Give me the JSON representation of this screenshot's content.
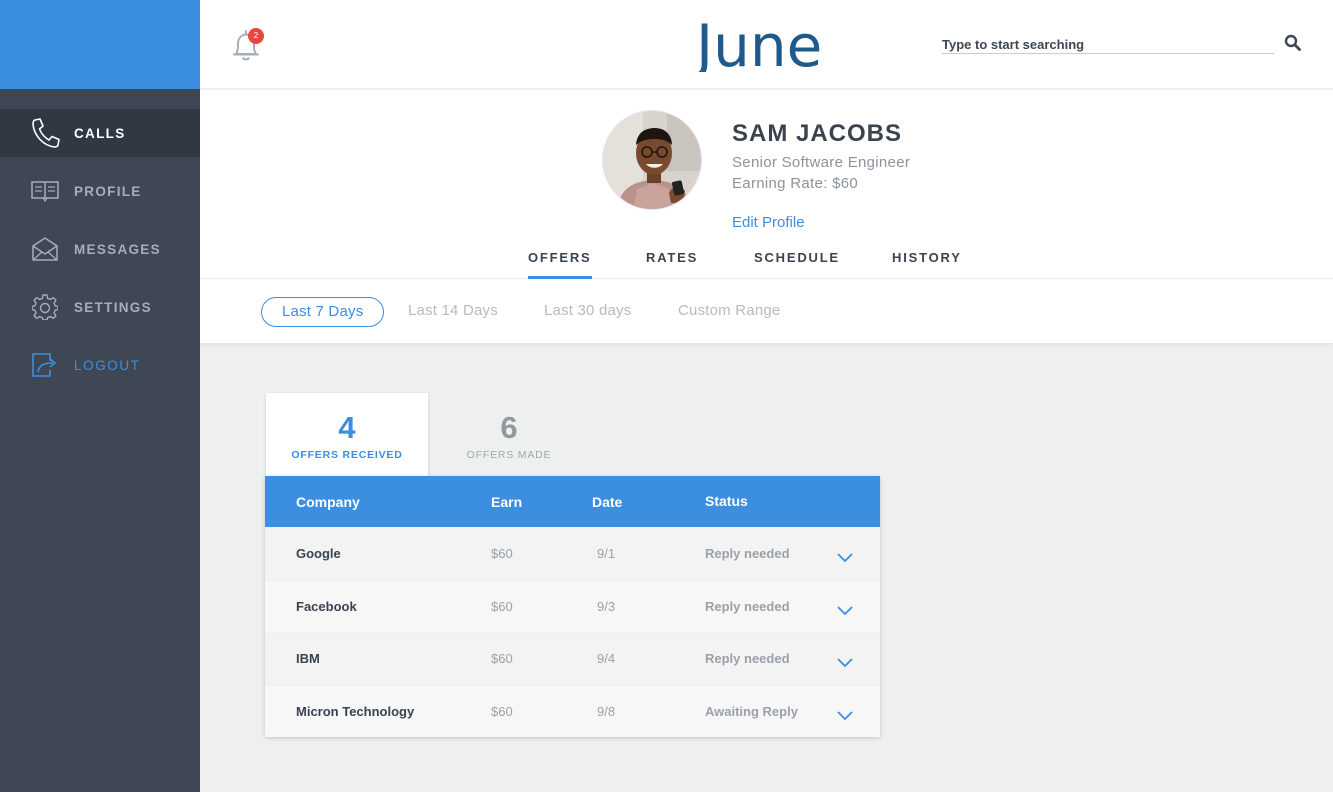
{
  "brand": {
    "logo_text": "June",
    "accent": "#3b8ee0",
    "sidebar_bg": "#3e4753"
  },
  "sidebar": {
    "items": [
      {
        "label": "CALLS",
        "icon": "phone-icon"
      },
      {
        "label": "PROFILE",
        "icon": "book-icon"
      },
      {
        "label": "MESSAGES",
        "icon": "envelope-icon"
      },
      {
        "label": "SETTINGS",
        "icon": "gear-icon"
      },
      {
        "label": "LOGOUT",
        "icon": "logout-icon"
      }
    ]
  },
  "header": {
    "notification_count": "2",
    "search_placeholder": "Type to start searching"
  },
  "profile": {
    "name": "SAM JACOBS",
    "title": "Senior Software Engineer",
    "rate": "Earning Rate: $60",
    "edit_label": "Edit Profile"
  },
  "tabs": [
    "OFFERS",
    "RATES",
    "SCHEDULE",
    "HISTORY"
  ],
  "ranges": [
    "Last 7 Days",
    "Last 14 Days",
    "Last 30 days",
    "Custom Range"
  ],
  "stats": {
    "received": {
      "count": "4",
      "label": "OFFERS RECEIVED"
    },
    "made": {
      "count": "6",
      "label": "OFFERS MADE"
    }
  },
  "table": {
    "columns": [
      "Company",
      "Earn",
      "Date",
      "Status"
    ],
    "rows": [
      {
        "company": "Google",
        "earn": "$60",
        "date": "9/1",
        "status": "Reply needed"
      },
      {
        "company": "Facebook",
        "earn": "$60",
        "date": "9/3",
        "status": "Reply needed"
      },
      {
        "company": "IBM",
        "earn": "$60",
        "date": "9/4",
        "status": "Reply needed"
      },
      {
        "company": "Micron Technology",
        "earn": "$60",
        "date": "9/8",
        "status": "Awaiting Reply"
      }
    ]
  }
}
